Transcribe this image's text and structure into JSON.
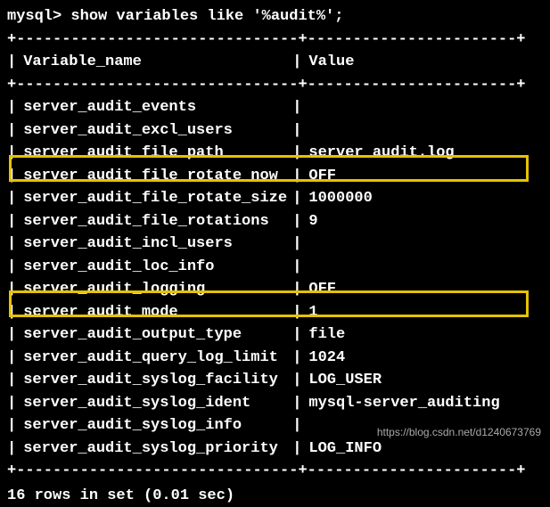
{
  "prompt": "mysql> show variables like '%audit%';",
  "border_top": "+-------------------------------+-----------------------+",
  "header": {
    "col1": "Variable_name",
    "col2": "Value"
  },
  "rows": [
    {
      "name": "server_audit_events",
      "value": ""
    },
    {
      "name": "server_audit_excl_users",
      "value": ""
    },
    {
      "name": "server_audit_file_path",
      "value": "server_audit.log"
    },
    {
      "name": "server_audit_file_rotate_now",
      "value": "OFF"
    },
    {
      "name": "server_audit_file_rotate_size",
      "value": "1000000"
    },
    {
      "name": "server_audit_file_rotations",
      "value": "9"
    },
    {
      "name": "server_audit_incl_users",
      "value": ""
    },
    {
      "name": "server_audit_loc_info",
      "value": ""
    },
    {
      "name": "server_audit_logging",
      "value": "OFF"
    },
    {
      "name": "server_audit_mode",
      "value": "1"
    },
    {
      "name": "server_audit_output_type",
      "value": "file"
    },
    {
      "name": "server_audit_query_log_limit",
      "value": "1024"
    },
    {
      "name": "server_audit_syslog_facility",
      "value": "LOG_USER"
    },
    {
      "name": "server_audit_syslog_ident",
      "value": "mysql-server_auditing"
    },
    {
      "name": "server_audit_syslog_info",
      "value": ""
    },
    {
      "name": "server_audit_syslog_priority",
      "value": "LOG_INFO"
    }
  ],
  "footer": "16 rows in set (0.01 sec)",
  "watermark": "https://blog.csdn.net/d1240673769",
  "chart_data": {
    "type": "table",
    "title": "MySQL SHOW VARIABLES LIKE '%audit%'",
    "columns": [
      "Variable_name",
      "Value"
    ],
    "rows": [
      [
        "server_audit_events",
        ""
      ],
      [
        "server_audit_excl_users",
        ""
      ],
      [
        "server_audit_file_path",
        "server_audit.log"
      ],
      [
        "server_audit_file_rotate_now",
        "OFF"
      ],
      [
        "server_audit_file_rotate_size",
        "1000000"
      ],
      [
        "server_audit_file_rotations",
        "9"
      ],
      [
        "server_audit_incl_users",
        ""
      ],
      [
        "server_audit_loc_info",
        ""
      ],
      [
        "server_audit_logging",
        "OFF"
      ],
      [
        "server_audit_mode",
        "1"
      ],
      [
        "server_audit_output_type",
        "file"
      ],
      [
        "server_audit_query_log_limit",
        "1024"
      ],
      [
        "server_audit_syslog_facility",
        "LOG_USER"
      ],
      [
        "server_audit_syslog_ident",
        "mysql-server_auditing"
      ],
      [
        "server_audit_syslog_info",
        ""
      ],
      [
        "server_audit_syslog_priority",
        "LOG_INFO"
      ]
    ],
    "highlighted_rows": [
      "server_audit_file_path",
      "server_audit_logging"
    ]
  }
}
